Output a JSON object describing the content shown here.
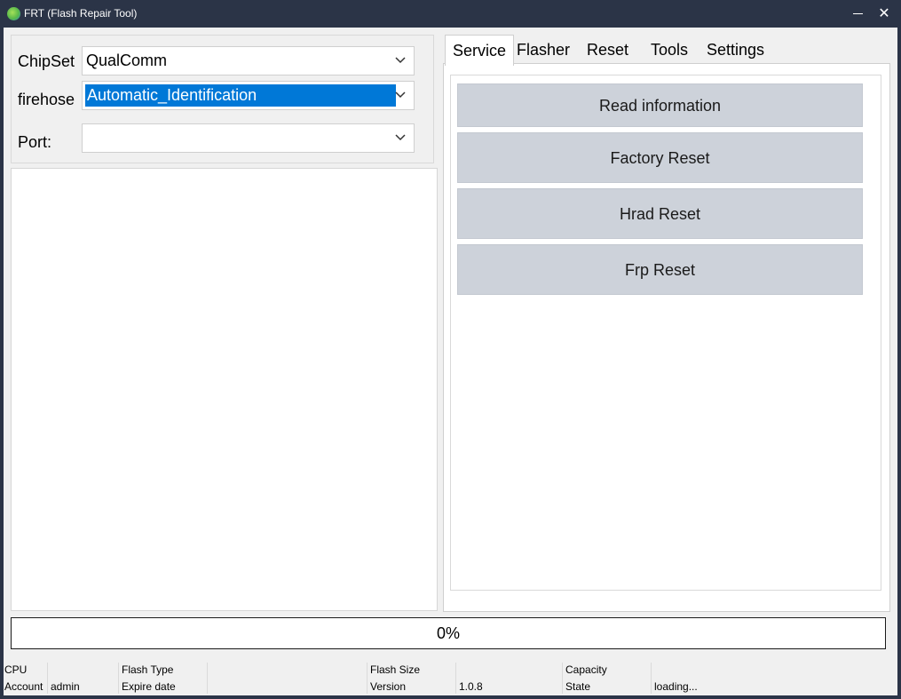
{
  "window": {
    "title": "FRT (Flash Repair Tool)",
    "minimize_glyph": "—",
    "close_glyph": "✕"
  },
  "config": {
    "chipset_label": "ChipSet",
    "chipset_value": "QualComm",
    "firehose_label": "firehose",
    "firehose_value": "Automatic_Identification",
    "port_label": "Port:",
    "port_value": ""
  },
  "tabs": [
    {
      "label": "Service",
      "active": true
    },
    {
      "label": "Flasher"
    },
    {
      "label": "Reset"
    },
    {
      "label": "Tools"
    },
    {
      "label": "Settings"
    }
  ],
  "service_actions": [
    {
      "label": "Read information"
    },
    {
      "label": "Factory Reset"
    },
    {
      "label": "Hrad Reset"
    },
    {
      "label": "Frp Reset"
    }
  ],
  "progress": {
    "percent": 0,
    "text": "0%"
  },
  "status": {
    "cpu_label": "CPU",
    "cpu_value": "",
    "flash_type_label": "Flash Type",
    "flash_type_value": "",
    "flash_size_label": "Flash Size",
    "flash_size_value": "",
    "capacity_label": "Capacity",
    "capacity_value": "",
    "account_label": "Account",
    "account_value": "admin",
    "expire_label": "Expire date",
    "expire_value": "",
    "version_label": "Version",
    "version_value": "1.0.8",
    "state_label": "State",
    "state_value": "loading..."
  },
  "colors": {
    "titlebar": "#2b3447",
    "selection": "#0078d7",
    "button_bg": "#cdd2da",
    "progress_fill": "#06b025"
  },
  "icons": {
    "app": "app-logo-icon",
    "dropdown": "chevron-down-icon"
  }
}
